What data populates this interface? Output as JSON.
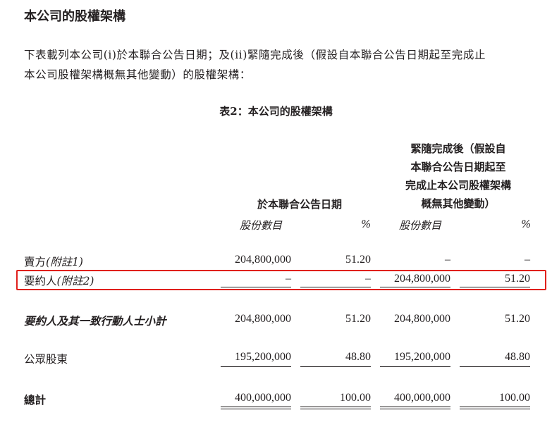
{
  "section_heading": "本公司的股權架構",
  "intro_line1": "下表載列本公司(i)於本聯合公告日期；及(ii)緊隨完成後（假設自本聯合公告日期起至完成止",
  "intro_line2": "本公司股權架構概無其他變動）的股權架構：",
  "table_title": "表2：本公司的股權架構",
  "col_group1": "於本聯合公告日期",
  "col_group2_lines": [
    "緊隨完成後（假設自",
    "本聯合公告日期起至",
    "完成止本公司股權架構",
    "概無其他變動）"
  ],
  "unit_shares": "股份數目",
  "unit_pct": "%",
  "rows": [
    {
      "label": "賣方",
      "note": "(附註1)",
      "shares1": "204,800,000",
      "pct1": "51.20",
      "shares2": "–",
      "pct2": "–"
    },
    {
      "label": "要約人",
      "note": "(附註2)",
      "shares1": "–",
      "pct1": "–",
      "shares2": "204,800,000",
      "pct2": "51.20"
    },
    {
      "label": "要約人及其一致行動人士小計",
      "note": "",
      "shares1": "204,800,000",
      "pct1": "51.20",
      "shares2": "204,800,000",
      "pct2": "51.20"
    },
    {
      "label": "公眾股東",
      "note": "",
      "shares1": "195,200,000",
      "pct1": "48.80",
      "shares2": "195,200,000",
      "pct2": "48.80"
    },
    {
      "label": "總計",
      "note": "",
      "shares1": "400,000,000",
      "pct1": "100.00",
      "shares2": "400,000,000",
      "pct2": "100.00"
    }
  ],
  "highlight_color": "#e0201c"
}
